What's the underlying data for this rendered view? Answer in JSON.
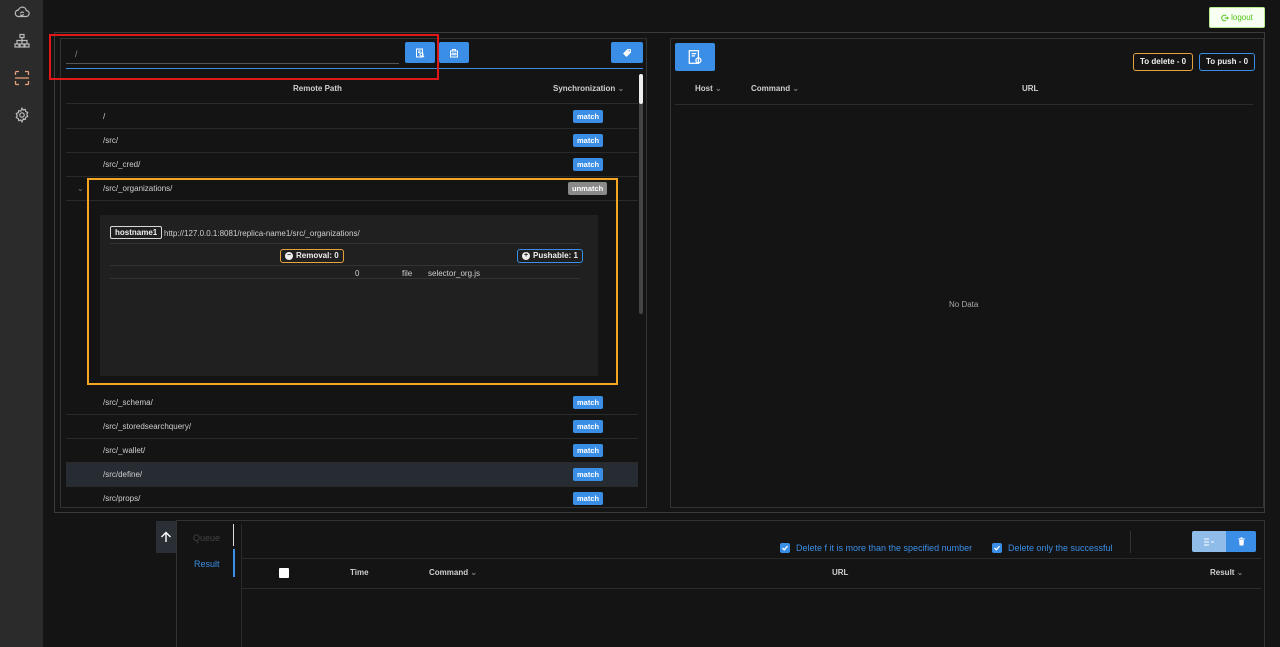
{
  "rail": {
    "icons": [
      "cloud-sync-icon",
      "sitemap-icon",
      "scan-icon",
      "gear-icon"
    ],
    "active_color": "#e8a07a"
  },
  "logout": {
    "label": "logout"
  },
  "left": {
    "path_value": "/",
    "columns": {
      "remote_path": "Remote Path",
      "synchronization": "Synchronization"
    },
    "rows": [
      {
        "path": "/",
        "status": "match"
      },
      {
        "path": "/src/",
        "status": "match"
      },
      {
        "path": "/src/_cred/",
        "status": "match"
      },
      {
        "path": "/src/_organizations/",
        "status": "unmatch"
      },
      {
        "path": "/src/_schema/",
        "status": "match"
      },
      {
        "path": "/src/_storedsearchquery/",
        "status": "match"
      },
      {
        "path": "/src/_wallet/",
        "status": "match"
      },
      {
        "path": "/src/define/",
        "status": "match"
      },
      {
        "path": "/src/props/",
        "status": "match"
      }
    ],
    "detail": {
      "host": "hostname1",
      "url": "http://127.0.0.1:8081/replica-name1/src/_organizations/",
      "removal": "Removal: 0",
      "pushable": "Pushable: 1",
      "file_row": {
        "index": "0",
        "type": "file",
        "name": "selector_org.js"
      }
    }
  },
  "right": {
    "to_delete": "To delete - 0",
    "to_push": "To push - 0",
    "columns": {
      "host": "Host",
      "command": "Command",
      "url": "URL"
    },
    "empty": "No Data"
  },
  "bottom": {
    "tabs": {
      "queue": "Queue",
      "result": "Result"
    },
    "checkbox1": "Delete f it is more than the specified number",
    "checkbox2": "Delete only the successful",
    "columns": {
      "time": "Time",
      "command": "Command",
      "url": "URL",
      "result": "Result"
    }
  },
  "colors": {
    "accent": "#3a8ee6",
    "warning": "#e6a23c",
    "highlight_red": "#e01818",
    "highlight_yellow": "#f5a623"
  }
}
